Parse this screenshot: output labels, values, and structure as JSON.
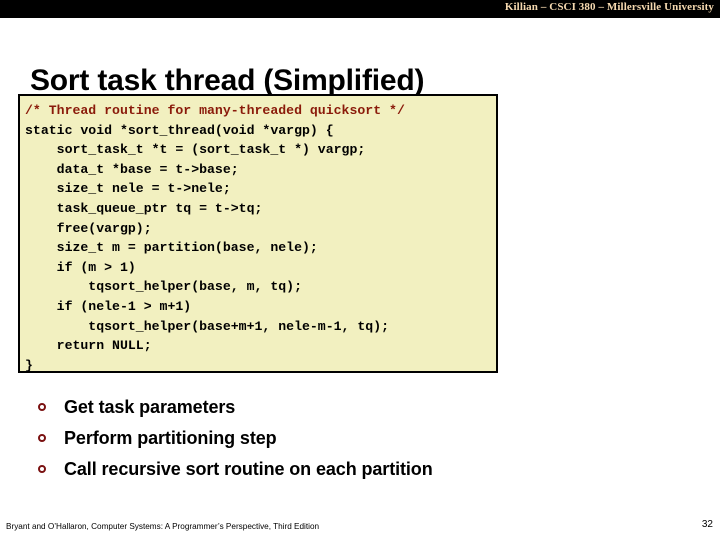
{
  "banner": {
    "text": "Killian – CSCI 380 – Millersville University",
    "background_color": "#000000",
    "text_color": "#f5d9b0"
  },
  "slide": {
    "title": "Sort task thread (Simplified)",
    "page_number": "32"
  },
  "code": {
    "background_color": "#f2f0c0",
    "border_color": "#000000",
    "comment_color": "#8a1a0a",
    "text_color": "#000000",
    "lines": [
      {
        "text": "/* Thread routine for many-threaded quicksort */",
        "style": "comment"
      },
      {
        "text": "static void *sort_thread(void *vargp) {",
        "style": "plain"
      },
      {
        "text": "    sort_task_t *t = (sort_task_t *) vargp;",
        "style": "plain"
      },
      {
        "text": "    data_t *base = t->base;",
        "style": "plain"
      },
      {
        "text": "    size_t nele = t->nele;",
        "style": "plain"
      },
      {
        "text": "    task_queue_ptr tq = t->tq;",
        "style": "plain"
      },
      {
        "text": "    free(vargp);",
        "style": "plain"
      },
      {
        "text": "    size_t m = partition(base, nele);",
        "style": "plain"
      },
      {
        "text": "    if (m > 1)",
        "style": "plain"
      },
      {
        "text": "        tqsort_helper(base, m, tq);",
        "style": "plain"
      },
      {
        "text": "    if (nele-1 > m+1)",
        "style": "plain"
      },
      {
        "text": "        tqsort_helper(base+m+1, nele-m-1, tq);",
        "style": "plain"
      },
      {
        "text": "    return NULL;",
        "style": "plain"
      },
      {
        "text": "}",
        "style": "plain"
      }
    ]
  },
  "bullets": {
    "marker_color": "#7a1111",
    "items": [
      {
        "label": "Get task parameters"
      },
      {
        "label": "Perform partitioning step"
      },
      {
        "label": "Call recursive sort routine on each partition"
      }
    ]
  },
  "footer": {
    "citation": "Bryant and O’Hallaron, Computer Systems: A Programmer’s Perspective, Third Edition"
  }
}
